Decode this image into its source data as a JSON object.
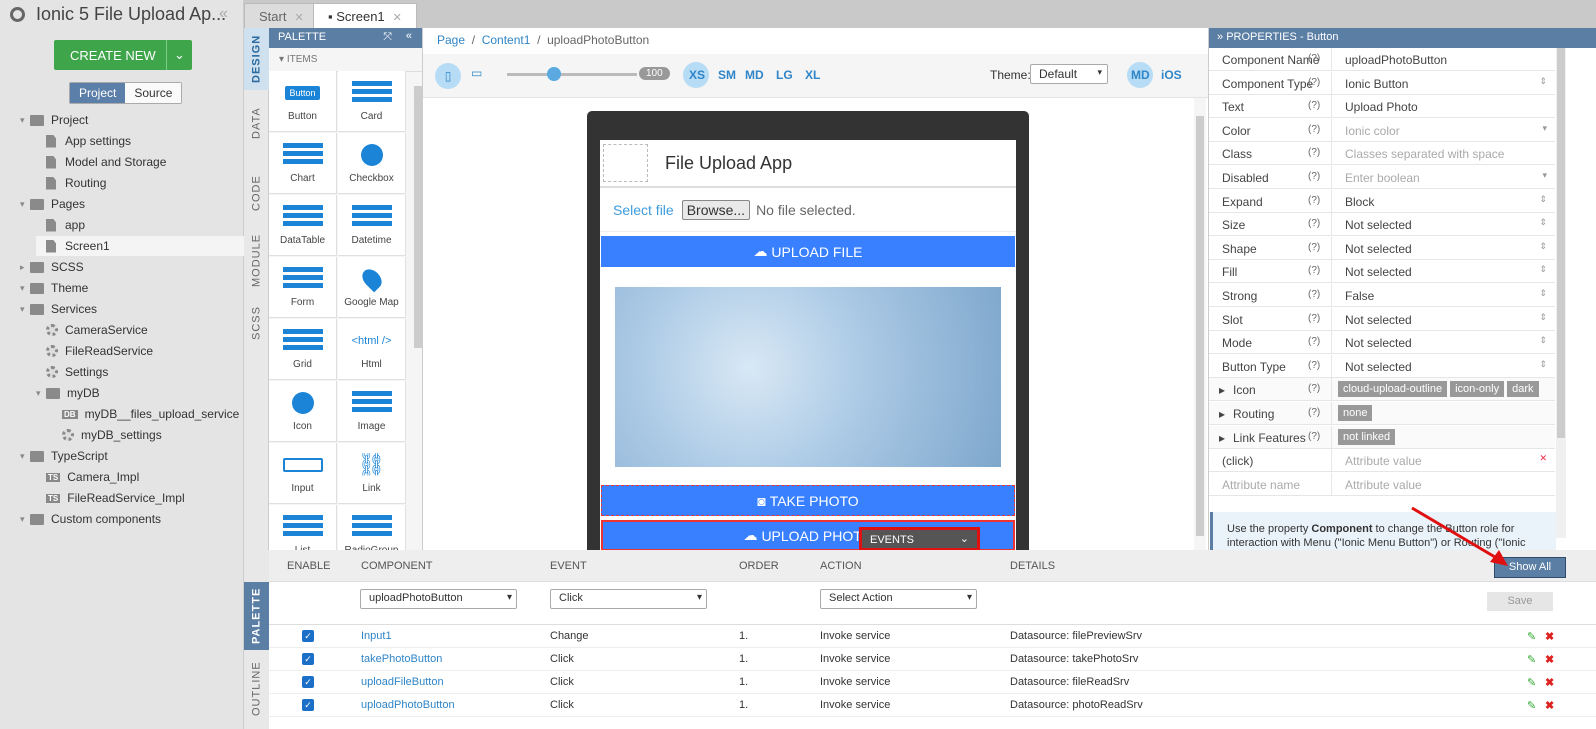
{
  "sidebar": {
    "app_title": "Ionic 5 File Upload Ap...",
    "create_label": "CREATE NEW",
    "toggle": [
      "Project",
      "Source"
    ],
    "tree": [
      {
        "label": "Project",
        "type": "folder",
        "level": 0
      },
      {
        "label": "App settings",
        "type": "file",
        "level": 1
      },
      {
        "label": "Model and Storage",
        "type": "file",
        "level": 1
      },
      {
        "label": "Routing",
        "type": "file",
        "level": 1
      },
      {
        "label": "Pages",
        "type": "folder",
        "level": 0
      },
      {
        "label": "app",
        "type": "file",
        "level": 1
      },
      {
        "label": "Screen1",
        "type": "file",
        "level": 1
      },
      {
        "label": "SCSS",
        "type": "folder",
        "level": 0
      },
      {
        "label": "Theme",
        "type": "folder",
        "level": 0
      },
      {
        "label": "Services",
        "type": "folder",
        "level": 0
      },
      {
        "label": "CameraService",
        "type": "gear",
        "level": 1
      },
      {
        "label": "FileReadService",
        "type": "gear",
        "level": 1
      },
      {
        "label": "Settings",
        "type": "gear",
        "level": 1
      },
      {
        "label": "myDB",
        "type": "folder",
        "level": 1
      },
      {
        "label": "myDB__files_upload_service",
        "type": "db",
        "level": 2
      },
      {
        "label": "myDB_settings",
        "type": "gear",
        "level": 2
      },
      {
        "label": "TypeScript",
        "type": "folder",
        "level": 0
      },
      {
        "label": "Camera_Impl",
        "type": "ts",
        "level": 1
      },
      {
        "label": "FileReadService_Impl",
        "type": "ts",
        "level": 1
      },
      {
        "label": "Custom components",
        "type": "folder",
        "level": 0
      }
    ],
    "badges": {
      "db": "DB",
      "ts": "TS"
    }
  },
  "tabs": [
    "Start",
    "Screen1"
  ],
  "vtabs": [
    "DESIGN",
    "DATA",
    "CODE",
    "MODULE",
    "SCSS"
  ],
  "bottom_vtabs": [
    "PALETTE",
    "OUTLINE"
  ],
  "palette": {
    "title": "PALETTE",
    "section": "ITEMS",
    "items": [
      "Button",
      "Card",
      "Chart",
      "Checkbox",
      "DataTable",
      "Datetime",
      "Form",
      "Google Map",
      "Grid",
      "Html",
      "Icon",
      "Image",
      "Input",
      "Link",
      "List",
      "RadioGroup"
    ],
    "button_preview": "Button",
    "html_preview": "<html />"
  },
  "breadcrumb": [
    "Page",
    "Content1",
    "uploadPhotoButton"
  ],
  "toolbar": {
    "zoom": "100",
    "breakpoints": [
      "XS",
      "SM",
      "MD",
      "LG",
      "XL"
    ],
    "theme_label": "Theme:",
    "theme_value": "Default",
    "modes": [
      "MD",
      "iOS"
    ]
  },
  "phone": {
    "title": "File Upload App",
    "select_file": "Select file",
    "browse": "Browse...",
    "no_file": "No file selected.",
    "upload_file": "UPLOAD FILE",
    "take_photo": "TAKE PHOTO",
    "upload_photo": "UPLOAD PHOTO"
  },
  "events_badge": "EVENTS",
  "properties": {
    "title": "PROPERTIES - Button",
    "rows": [
      {
        "k": "Component Name",
        "v": "uploadPhotoButton",
        "ph": false
      },
      {
        "k": "Component Type",
        "v": "Ionic Button",
        "ph": false
      },
      {
        "k": "Text",
        "v": "Upload Photo",
        "ph": false
      },
      {
        "k": "Color",
        "v": "Ionic color",
        "ph": true
      },
      {
        "k": "Class",
        "v": "Classes separated with space",
        "ph": true
      },
      {
        "k": "Disabled",
        "v": "Enter boolean",
        "ph": true
      },
      {
        "k": "Expand",
        "v": "Block",
        "ph": false
      },
      {
        "k": "Size",
        "v": "Not selected",
        "ph": false
      },
      {
        "k": "Shape",
        "v": "Not selected",
        "ph": false
      },
      {
        "k": "Fill",
        "v": "Not selected",
        "ph": false
      },
      {
        "k": "Strong",
        "v": "False",
        "ph": false
      },
      {
        "k": "Slot",
        "v": "Not selected",
        "ph": false
      },
      {
        "k": "Mode",
        "v": "Not selected",
        "ph": false
      },
      {
        "k": "Button Type",
        "v": "Not selected",
        "ph": false
      }
    ],
    "icon_label": "Icon",
    "icon_pills": [
      "cloud-upload-outline",
      "icon-only",
      "dark"
    ],
    "routing_label": "Routing",
    "routing_pill": "none",
    "link_label": "Link Features",
    "link_pill": "not linked",
    "attr_name": "(click)",
    "attr_value_ph": "Attribute value",
    "attr_name_ph": "Attribute name",
    "hint_pre": "Use the property ",
    "hint_bold": "Component",
    "hint_post": " to change the Button role for interaction with Menu (\"Ionic Menu Button\") or Routing (\"Ionic"
  },
  "events": {
    "headers": [
      "ENABLE",
      "COMPONENT",
      "EVENT",
      "ORDER",
      "ACTION",
      "DETAILS"
    ],
    "component_select": "uploadPhotoButton",
    "event_select": "Click",
    "action_select": "Select Action",
    "save": "Save",
    "show_all": "Show All",
    "rows": [
      {
        "component": "Input1",
        "event": "Change",
        "order": "1.",
        "action": "Invoke service",
        "details": "Datasource: filePreviewSrv"
      },
      {
        "component": "takePhotoButton",
        "event": "Click",
        "order": "1.",
        "action": "Invoke service",
        "details": "Datasource: takePhotoSrv"
      },
      {
        "component": "uploadFileButton",
        "event": "Click",
        "order": "1.",
        "action": "Invoke service",
        "details": "Datasource: fileReadSrv"
      },
      {
        "component": "uploadPhotoButton",
        "event": "Click",
        "order": "1.",
        "action": "Invoke service",
        "details": "Datasource: photoReadSrv"
      }
    ]
  },
  "colors": {
    "accent": "#5a7ea4",
    "ionic_primary": "#3880ff",
    "create_green": "#3ea54b",
    "highlight_red": "#e01010"
  }
}
